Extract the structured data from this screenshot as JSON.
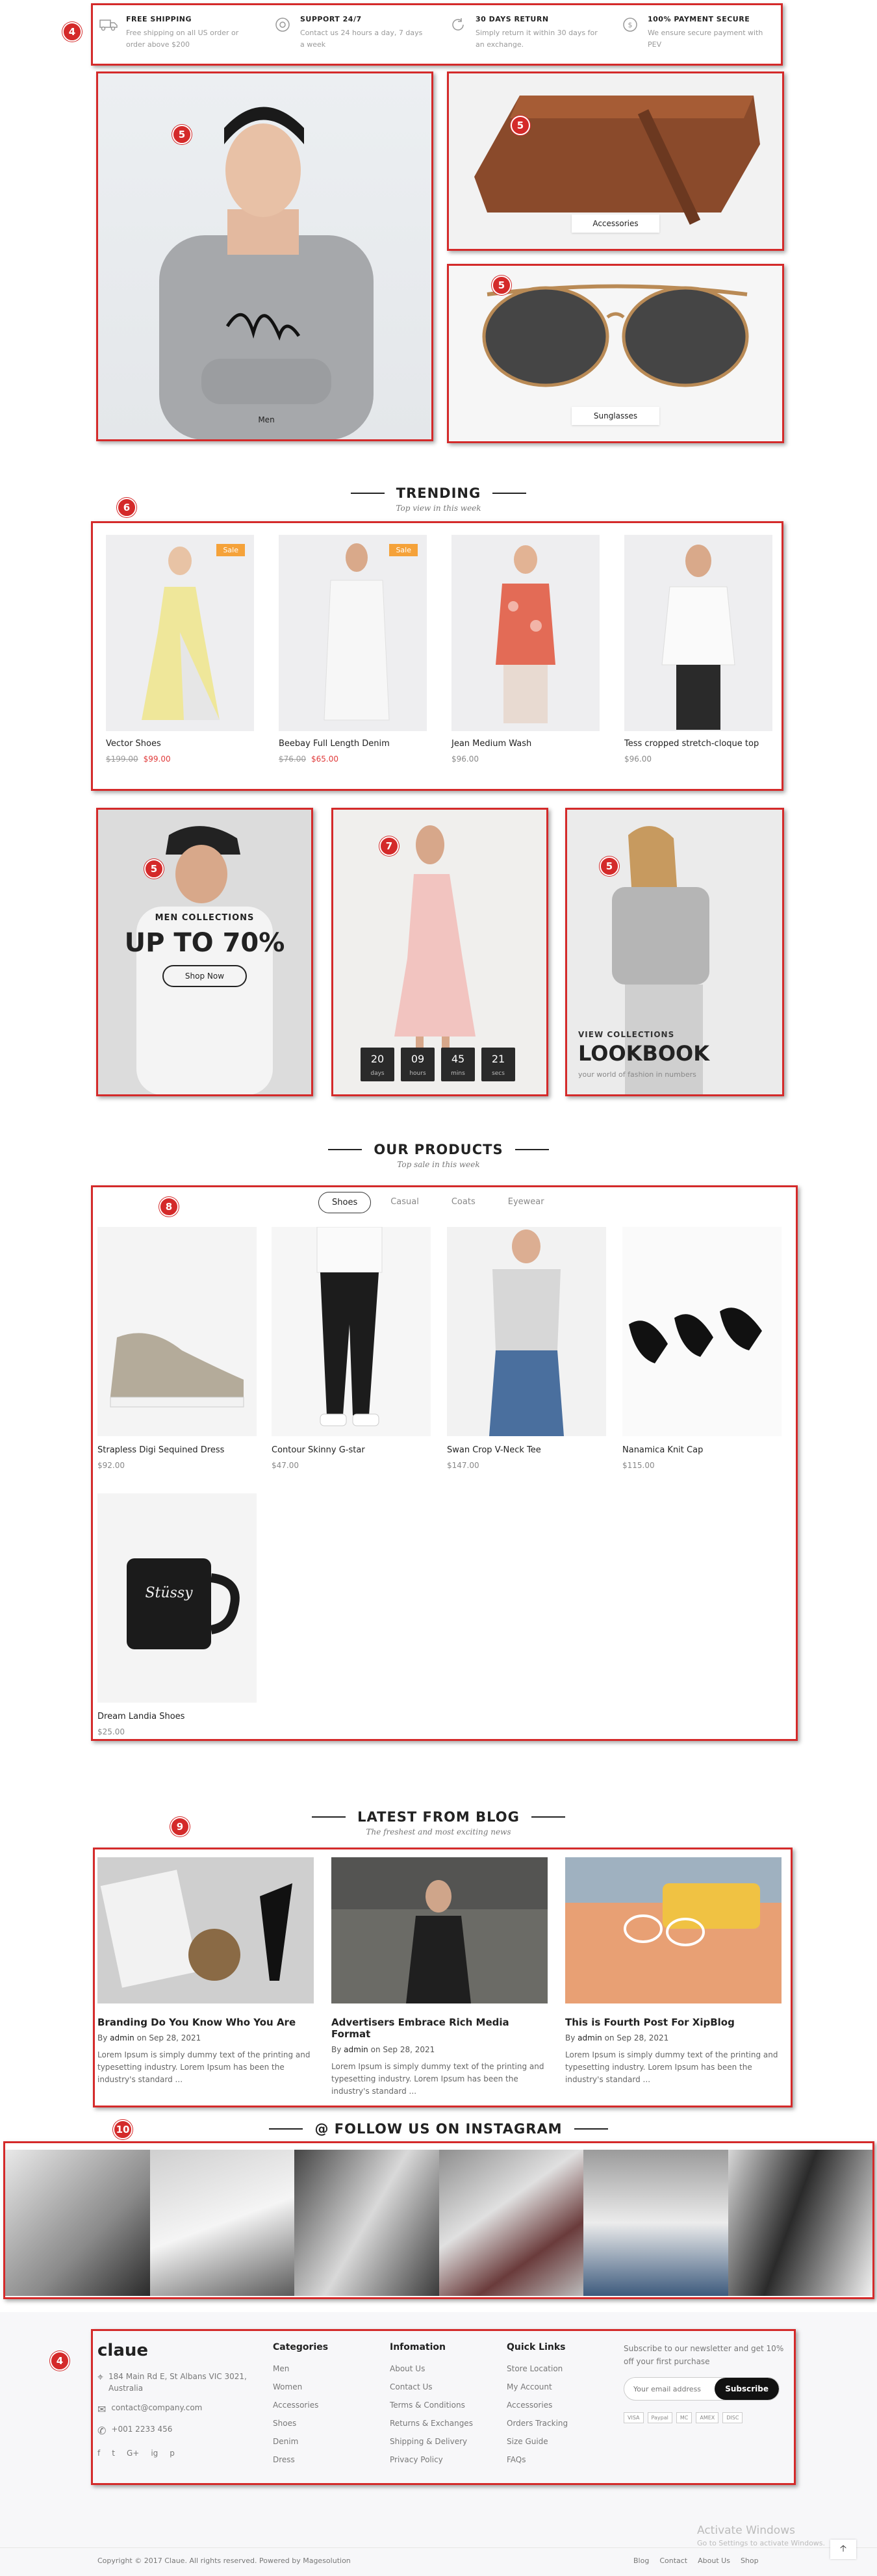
{
  "badges": [
    "4",
    "5",
    "5",
    "5",
    "6",
    "5",
    "7",
    "5",
    "8",
    "9",
    "10",
    "4"
  ],
  "services": [
    {
      "icon": "truck-icon",
      "title": "FREE SHIPPING",
      "text": "Free shipping on all US order or order above $200"
    },
    {
      "icon": "support-icon",
      "title": "SUPPORT 24/7",
      "text": "Contact us 24 hours a day, 7 days a week"
    },
    {
      "icon": "return-icon",
      "title": "30 DAYS RETURN",
      "text": "Simply return it within 30 days for an exchange."
    },
    {
      "icon": "secure-payment-icon",
      "title": "100% PAYMENT SECURE",
      "text": "We ensure secure payment with PEV"
    }
  ],
  "banners": {
    "men": "Men",
    "accessories": "Accessories",
    "sunglasses": "Sunglasses"
  },
  "trending": {
    "title": "TRENDING",
    "subtitle": "Top view in this week",
    "products": [
      {
        "name": "Vector Shoes",
        "old": "$199.00",
        "price": "$99.00",
        "sale": "Sale"
      },
      {
        "name": "Beebay Full Length Denim",
        "old": "$76.00",
        "price": "$65.00",
        "sale": "Sale"
      },
      {
        "name": "Jean Medium Wash",
        "old": "",
        "price": "$96.00",
        "sale": ""
      },
      {
        "name": "Tess cropped stretch-cloque top",
        "old": "",
        "price": "$96.00",
        "sale": ""
      }
    ]
  },
  "promo": {
    "men_sub": "MEN COLLECTIONS",
    "men_title": "UP TO 70%",
    "men_btn": "Shop Now",
    "countdown": [
      {
        "v": "20",
        "l": "days"
      },
      {
        "v": "09",
        "l": "hours"
      },
      {
        "v": "45",
        "l": "mins"
      },
      {
        "v": "21",
        "l": "secs"
      }
    ],
    "look_sub": "VIEW COLLECTIONS",
    "look_title": "LOOKBOOK",
    "look_text": "your world of fashion in numbers"
  },
  "our_products": {
    "title": "OUR PRODUCTS",
    "subtitle": "Top sale in this week",
    "tabs": [
      "Shoes",
      "Casual",
      "Coats",
      "Eyewear"
    ],
    "products": [
      {
        "name": "Strapless Digi Sequined Dress",
        "price": "$92.00"
      },
      {
        "name": "Contour Skinny G-star",
        "price": "$47.00"
      },
      {
        "name": "Swan Crop V-Neck Tee",
        "price": "$147.00"
      },
      {
        "name": "Nanamica Knit Cap",
        "price": "$115.00"
      },
      {
        "name": "Dream Landia Shoes",
        "price": "$25.00"
      }
    ]
  },
  "blog": {
    "title": "LATEST FROM BLOG",
    "subtitle": "The freshest and most exciting news",
    "posts": [
      {
        "title": "Branding Do You Know Who You Are",
        "by": "By",
        "author": "admin",
        "on": "on",
        "date": "Sep 28, 2021",
        "excerpt": "Lorem Ipsum is simply dummy text of the printing and typesetting industry. Lorem Ipsum has been the industry's standard ..."
      },
      {
        "title": "Advertisers Embrace Rich Media Format",
        "by": "By",
        "author": "admin",
        "on": "on",
        "date": "Sep 28, 2021",
        "excerpt": "Lorem Ipsum is simply dummy text of the printing and typesetting industry. Lorem Ipsum has been the industry's standard ..."
      },
      {
        "title": "This is Fourth Post For XipBlog",
        "by": "By",
        "author": "admin",
        "on": "on",
        "date": "Sep 28, 2021",
        "excerpt": "Lorem Ipsum is simply dummy text of the printing and typesetting industry. Lorem Ipsum has been the industry's standard ..."
      }
    ]
  },
  "instagram": {
    "title": "@ FOLLOW US ON INSTAGRAM"
  },
  "footer": {
    "logo": "claue",
    "address": "184 Main Rd E, St Albans VIC 3021, Australia",
    "email": "contact@company.com",
    "phone": "+001 2233 456",
    "social": [
      "f",
      "t",
      "G+",
      "ig",
      "p"
    ],
    "columns": [
      {
        "title": "Categories",
        "links": [
          "Men",
          "Women",
          "Accessories",
          "Shoes",
          "Denim",
          "Dress"
        ]
      },
      {
        "title": "Infomation",
        "links": [
          "About Us",
          "Contact Us",
          "Terms & Conditions",
          "Returns & Exchanges",
          "Shipping & Delivery",
          "Privacy Policy"
        ]
      },
      {
        "title": "Quick Links",
        "links": [
          "Store Location",
          "My Account",
          "Accessories",
          "Orders Tracking",
          "Size Guide",
          "FAQs"
        ]
      }
    ],
    "newsletter_text": "Subscribe to our newsletter and get 10% off your first purchase",
    "email_placeholder": "Your email address",
    "subscribe": "Subscribe",
    "payments": [
      "VISA",
      "Paypal",
      "MC",
      "AMEX",
      "DISC"
    ],
    "copyright": "Copyright © 2017 Claue. All rights reserved. Powered by Magesolution",
    "bottom_links": [
      "Blog",
      "Contact",
      "About Us",
      "Shop"
    ],
    "activate_title": "Activate Windows",
    "activate_sub": "Go to Settings to activate Windows."
  }
}
